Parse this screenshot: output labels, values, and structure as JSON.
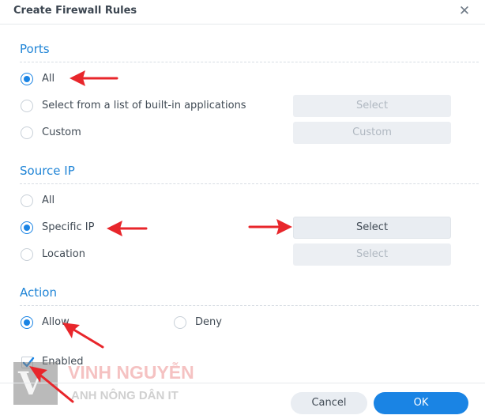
{
  "dialog": {
    "title": "Create Firewall Rules",
    "close_icon": "close-icon"
  },
  "ports": {
    "section_title": "Ports",
    "options": [
      {
        "label": "All",
        "checked": true
      },
      {
        "label": "Select from a list of built-in applications",
        "checked": false,
        "button": "Select",
        "button_enabled": false
      },
      {
        "label": "Custom",
        "checked": false,
        "button": "Custom",
        "button_enabled": false
      }
    ]
  },
  "source_ip": {
    "section_title": "Source IP",
    "options": [
      {
        "label": "All",
        "checked": false
      },
      {
        "label": "Specific IP",
        "checked": true,
        "button": "Select",
        "button_enabled": true
      },
      {
        "label": "Location",
        "checked": false,
        "button": "Select",
        "button_enabled": false
      }
    ]
  },
  "action": {
    "section_title": "Action",
    "options": [
      {
        "label": "Allow",
        "checked": true
      },
      {
        "label": "Deny",
        "checked": false
      }
    ]
  },
  "enabled": {
    "label": "Enabled",
    "checked": true
  },
  "footer": {
    "cancel": "Cancel",
    "ok": "OK"
  },
  "watermark": {
    "name": "VINH NGUYỄN",
    "sub": "ANH NÔNG DÂN IT",
    "logo_letter": "V"
  },
  "colors": {
    "accent": "#1a84e4",
    "section_title": "#1f84d6",
    "annotation_arrow": "#e8262b"
  }
}
